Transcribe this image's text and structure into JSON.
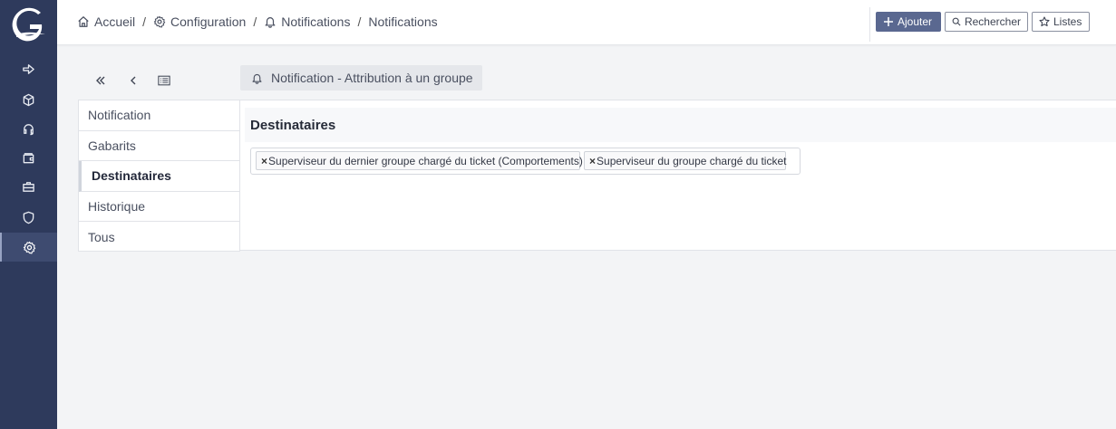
{
  "sidebar": {
    "logo_icon": "glpi-logo-icon",
    "items": [
      {
        "icon": "arrow-right-icon",
        "active": false
      },
      {
        "icon": "cube-icon",
        "active": false
      },
      {
        "icon": "headset-icon",
        "active": false
      },
      {
        "icon": "wallet-icon",
        "active": false
      },
      {
        "icon": "briefcase-icon",
        "active": false
      },
      {
        "icon": "shield-icon",
        "active": false
      },
      {
        "icon": "gear-icon",
        "active": true
      }
    ]
  },
  "breadcrumb": {
    "home": "Accueil",
    "config": "Configuration",
    "notifications": "Notifications",
    "current": "Notifications",
    "separator": "/"
  },
  "toolbar": {
    "add_label": "Ajouter",
    "search_label": "Rechercher",
    "lists_label": "Listes"
  },
  "page": {
    "title": "Notification - Attribution à un groupe"
  },
  "tabs": [
    {
      "label": "Notification"
    },
    {
      "label": "Gabarits"
    },
    {
      "label": "Destinataires"
    },
    {
      "label": "Historique"
    },
    {
      "label": "Tous"
    }
  ],
  "panel": {
    "heading": "Destinataires",
    "remove_symbol": "×",
    "recipients": [
      "Superviseur du dernier groupe chargé du ticket (Comportements)",
      "Superviseur du groupe chargé du ticket"
    ]
  },
  "colors": {
    "sidebar_bg": "#2e3a5c",
    "accent_button": "#5a6890",
    "page_bg": "#f3f4f6"
  }
}
